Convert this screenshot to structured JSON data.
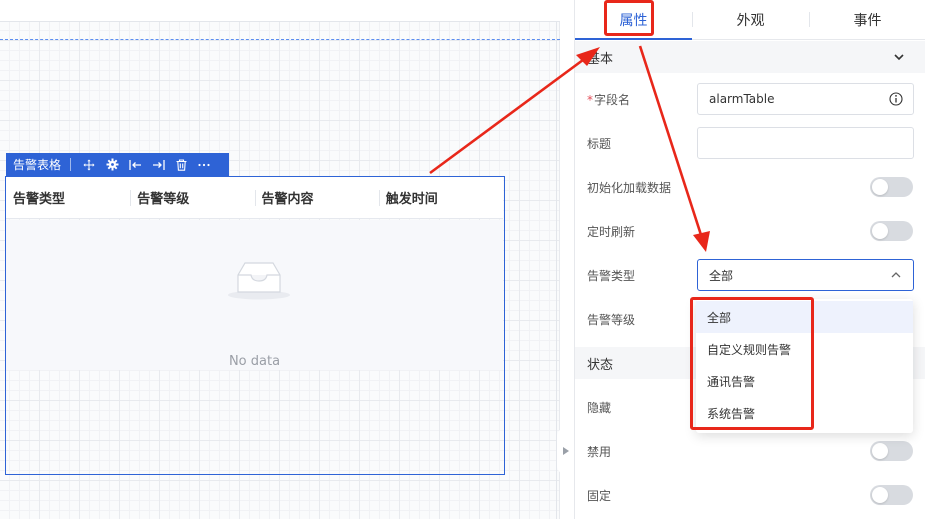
{
  "widget": {
    "toolbar_title": "告警表格",
    "toolbar_icons": [
      "move-icon",
      "settings-icon",
      "indent-left-icon",
      "indent-right-icon",
      "trash-icon",
      "more-icon"
    ],
    "columns": [
      "告警类型",
      "告警等级",
      "告警内容",
      "触发时间"
    ],
    "empty_text": "No data"
  },
  "panel": {
    "tabs": [
      "属性",
      "外观",
      "事件"
    ],
    "active_tab": "属性",
    "sections": {
      "basic": "基本",
      "state": "状态"
    },
    "fields": {
      "field_name_label": "字段名",
      "field_name_value": "alarmTable",
      "title_label": "标题",
      "title_value": "",
      "init_load_label": "初始化加载数据",
      "timer_refresh_label": "定时刷新",
      "alarm_type_label": "告警类型",
      "alarm_type_value": "全部",
      "alarm_level_label": "告警等级",
      "hidden_label": "隐藏",
      "disabled_label": "禁用",
      "fixed_label": "固定"
    },
    "alarm_type_options": [
      "全部",
      "自定义规则告警",
      "通讯告警",
      "系统告警"
    ],
    "alarm_type_selected": "全部"
  },
  "colors": {
    "accent": "#2e63d6",
    "annotation": "#e8271a",
    "required_mark": "#e34d59"
  }
}
